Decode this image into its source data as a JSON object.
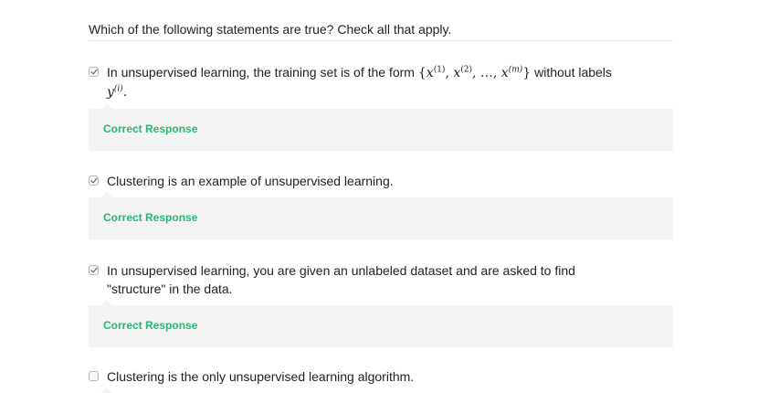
{
  "question": "Which of the following statements are true? Check all that apply.",
  "options": [
    {
      "checked": true,
      "text_before": "In unsupervised learning, the training set is of the form",
      "formula": "{x(1), x(2), …, x(m)}",
      "text_after": "without labels",
      "formula_tail": "y(i).",
      "feedback": "Correct Response"
    },
    {
      "checked": true,
      "text": "Clustering is an example of unsupervised learning.",
      "feedback": "Correct Response"
    },
    {
      "checked": true,
      "text": "In unsupervised learning, you are given an unlabeled dataset and are asked to find \"structure\" in the data.",
      "feedback": "Correct Response"
    },
    {
      "checked": false,
      "text": "Clustering is the only unsupervised learning algorithm."
    }
  ],
  "colors": {
    "correct": "#2bb673",
    "feedback_bg": "#f4f4f4"
  }
}
